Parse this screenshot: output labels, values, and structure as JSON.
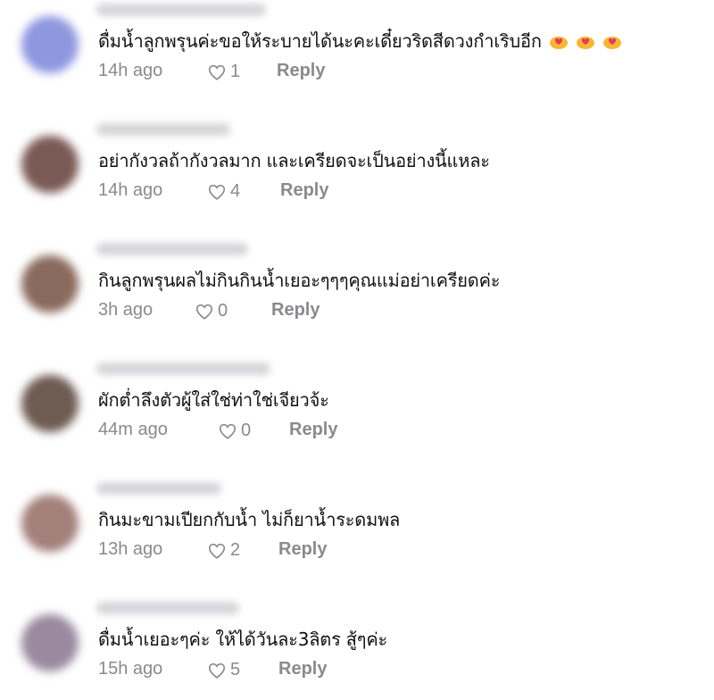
{
  "colors": {
    "text": "#111111",
    "meta": "#8a8a8e",
    "background": "#ffffff"
  },
  "comments": [
    {
      "text": "ดื่มน้ำลูกพรุนค่ะขอให้ระบายได้นะคะเดี๋ยวริดสีดวงกำเริบอีก",
      "time": "14h ago",
      "likes": "1",
      "reply": "Reply",
      "avatar_color": "#8f97e0",
      "emojis": [
        "hand-heart-icon",
        "hand-heart-icon",
        "hand-heart-icon"
      ]
    },
    {
      "text": "อย่ากังวลถ้ากังวลมาก และเครียดจะเป็นอย่างนี้แหละ",
      "time": "14h ago",
      "likes": "4",
      "reply": "Reply",
      "avatar_color": "#7a5a55",
      "emojis": []
    },
    {
      "text": "กินลูกพรุนผลไม่กินกินน้ำเยอะๆๆๆคุณแม่อย่าเครียดค่ะ",
      "time": "3h ago",
      "likes": "0",
      "reply": "Reply",
      "avatar_color": "#8a6a5c",
      "emojis": []
    },
    {
      "text": "ผักต่ำลึงตัวผู้ใส่ใช่ท่าใช่เจียวจ้ะ",
      "time": "44m ago",
      "likes": "0",
      "reply": "Reply",
      "avatar_color": "#6e5b52",
      "emojis": []
    },
    {
      "text": "กินมะขามเปียกกับน้ำ ไม่ก็ยาน้ำระดมพล",
      "time": "13h ago",
      "likes": "2",
      "reply": "Reply",
      "avatar_color": "#a3807a",
      "emojis": []
    },
    {
      "text": "ดื่มน้ำเยอะๆค่ะ ให้ได้วันละ3ลิตร สู้ๆค่ะ",
      "time": "15h ago",
      "likes": "5",
      "reply": "Reply",
      "avatar_color": "#9a8aa0",
      "emojis": []
    }
  ]
}
